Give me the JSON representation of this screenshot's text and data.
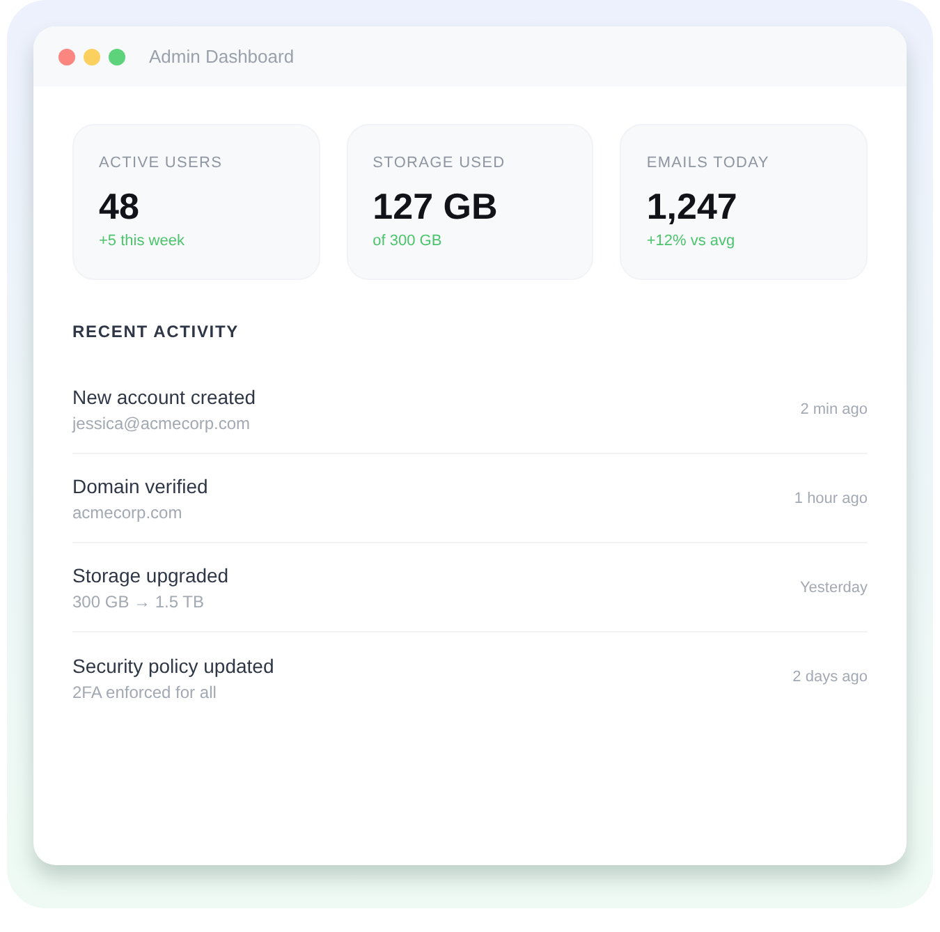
{
  "window": {
    "title": "Admin Dashboard"
  },
  "stats": [
    {
      "label": "ACTIVE USERS",
      "value": "48",
      "note": "+5 this week"
    },
    {
      "label": "STORAGE USED",
      "value": "127 GB",
      "note": "of 300 GB"
    },
    {
      "label": "EMAILS TODAY",
      "value": "1,247",
      "note": "+12% vs avg"
    }
  ],
  "recent_activity": {
    "heading": "RECENT ACTIVITY",
    "items": [
      {
        "title": "New account created",
        "detail": "jessica@acmecorp.com",
        "time": "2 min ago"
      },
      {
        "title": "Domain verified",
        "detail": "acmecorp.com",
        "time": "1 hour ago"
      },
      {
        "title": "Storage upgraded",
        "detail": "300 GB → 1.5 TB",
        "time": "Yesterday"
      },
      {
        "title": "Security policy updated",
        "detail": "2FA enforced for all",
        "time": "2 days ago"
      }
    ]
  }
}
